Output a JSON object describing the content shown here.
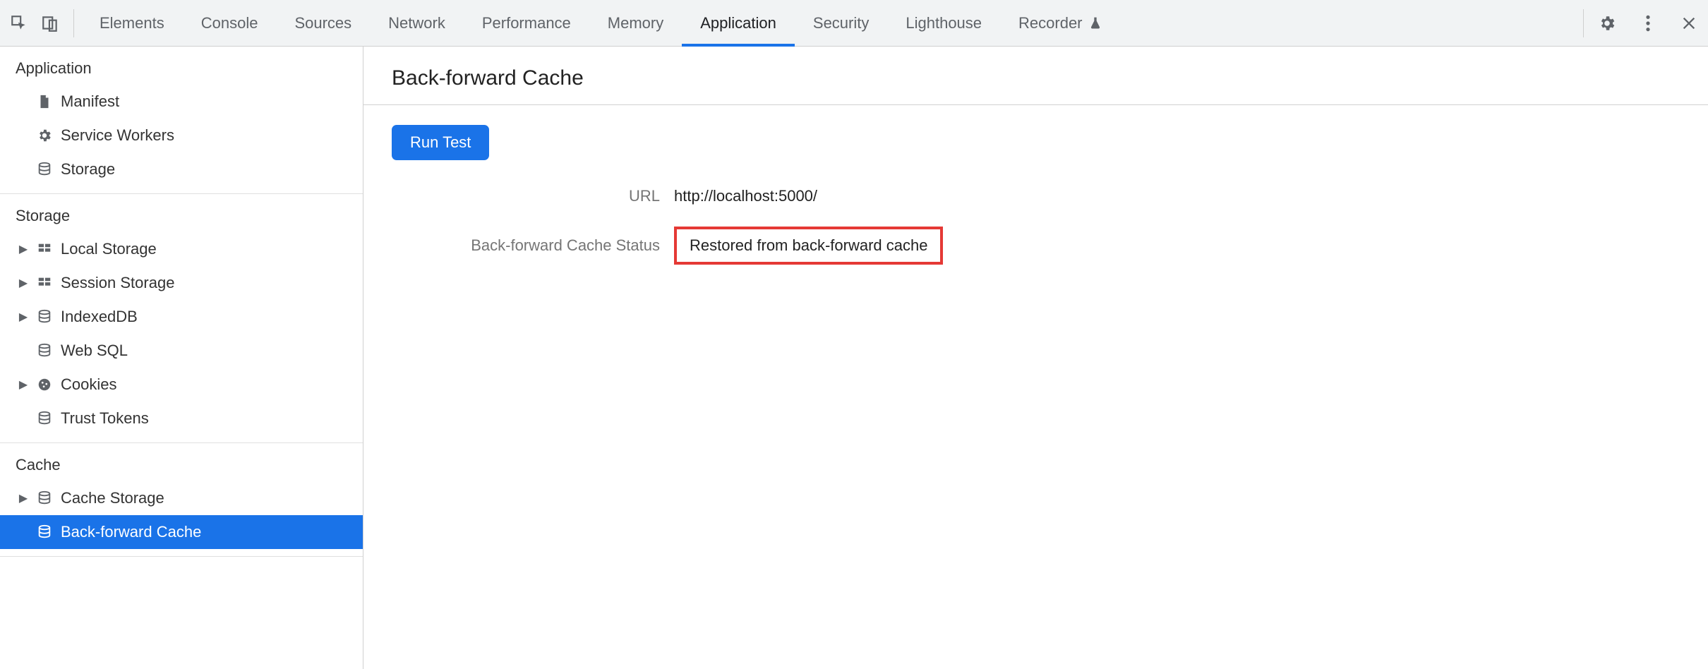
{
  "tabs": [
    {
      "label": "Elements"
    },
    {
      "label": "Console"
    },
    {
      "label": "Sources"
    },
    {
      "label": "Network"
    },
    {
      "label": "Performance"
    },
    {
      "label": "Memory"
    },
    {
      "label": "Application",
      "active": true
    },
    {
      "label": "Security"
    },
    {
      "label": "Lighthouse"
    },
    {
      "label": "Recorder",
      "flask": true
    }
  ],
  "sidebar": {
    "sections": [
      {
        "heading": "Application",
        "items": [
          {
            "label": "Manifest",
            "icon": "file"
          },
          {
            "label": "Service Workers",
            "icon": "gear"
          },
          {
            "label": "Storage",
            "icon": "db"
          }
        ]
      },
      {
        "heading": "Storage",
        "items": [
          {
            "label": "Local Storage",
            "icon": "grid",
            "expandable": true
          },
          {
            "label": "Session Storage",
            "icon": "grid",
            "expandable": true
          },
          {
            "label": "IndexedDB",
            "icon": "db",
            "expandable": true
          },
          {
            "label": "Web SQL",
            "icon": "db"
          },
          {
            "label": "Cookies",
            "icon": "cookie",
            "expandable": true
          },
          {
            "label": "Trust Tokens",
            "icon": "db"
          }
        ]
      },
      {
        "heading": "Cache",
        "items": [
          {
            "label": "Cache Storage",
            "icon": "db",
            "expandable": true
          },
          {
            "label": "Back-forward Cache",
            "icon": "db",
            "selected": true
          }
        ]
      }
    ]
  },
  "main": {
    "title": "Back-forward Cache",
    "run_label": "Run Test",
    "url_label": "URL",
    "url_value": "http://localhost:5000/",
    "status_label": "Back-forward Cache Status",
    "status_value": "Restored from back-forward cache"
  }
}
